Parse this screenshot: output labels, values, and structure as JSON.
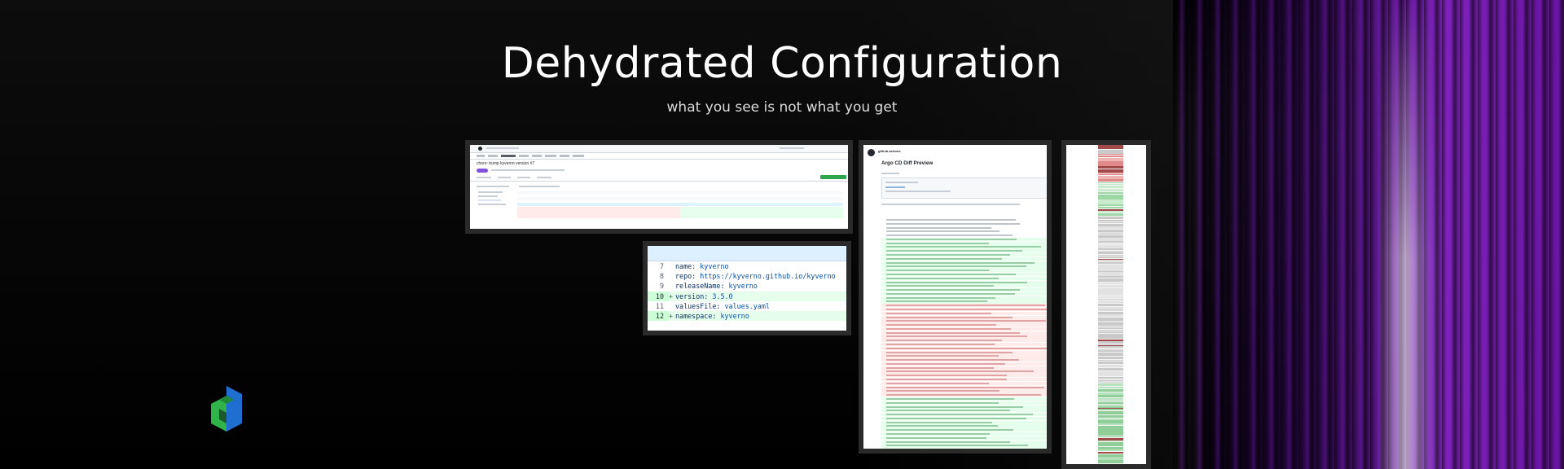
{
  "slide": {
    "title": "Dehydrated Configuration",
    "subtitle": "what you see is not what you get"
  },
  "pr_screenshot": {
    "pr_title": "chore: bump kyverno version #7"
  },
  "code_snippet": {
    "lines": [
      {
        "num": "7",
        "marker": "",
        "key": "name:",
        "value": " kyverno",
        "added": false
      },
      {
        "num": "8",
        "marker": "",
        "key": "repo:",
        "value": " https://kyverno.github.io/kyverno",
        "added": false
      },
      {
        "num": "9",
        "marker": "",
        "key": "releaseName:",
        "value": " kyverno",
        "added": false
      },
      {
        "num": "10",
        "marker": "+",
        "key": "version:",
        "value": " 3.5.0",
        "added": true
      },
      {
        "num": "11",
        "marker": "",
        "key": "valuesFile:",
        "value": " values.yaml",
        "added": true
      },
      {
        "num": "12",
        "marker": "+",
        "key": "namespace:",
        "value": " kyverno",
        "added": true
      }
    ]
  },
  "argo_comment": {
    "author": "github-actions",
    "title": "Argo CD Diff Preview"
  },
  "logo": {
    "name": "cube-logo-icon",
    "colors": {
      "green": "#2fb34a",
      "blue": "#1f6fd1",
      "dark_green": "#1e8a35"
    }
  },
  "colors": {
    "background": "#000000",
    "curtain": "#8a2be2",
    "diff_added": "#e6ffec",
    "diff_removed": "#ffebe9"
  }
}
